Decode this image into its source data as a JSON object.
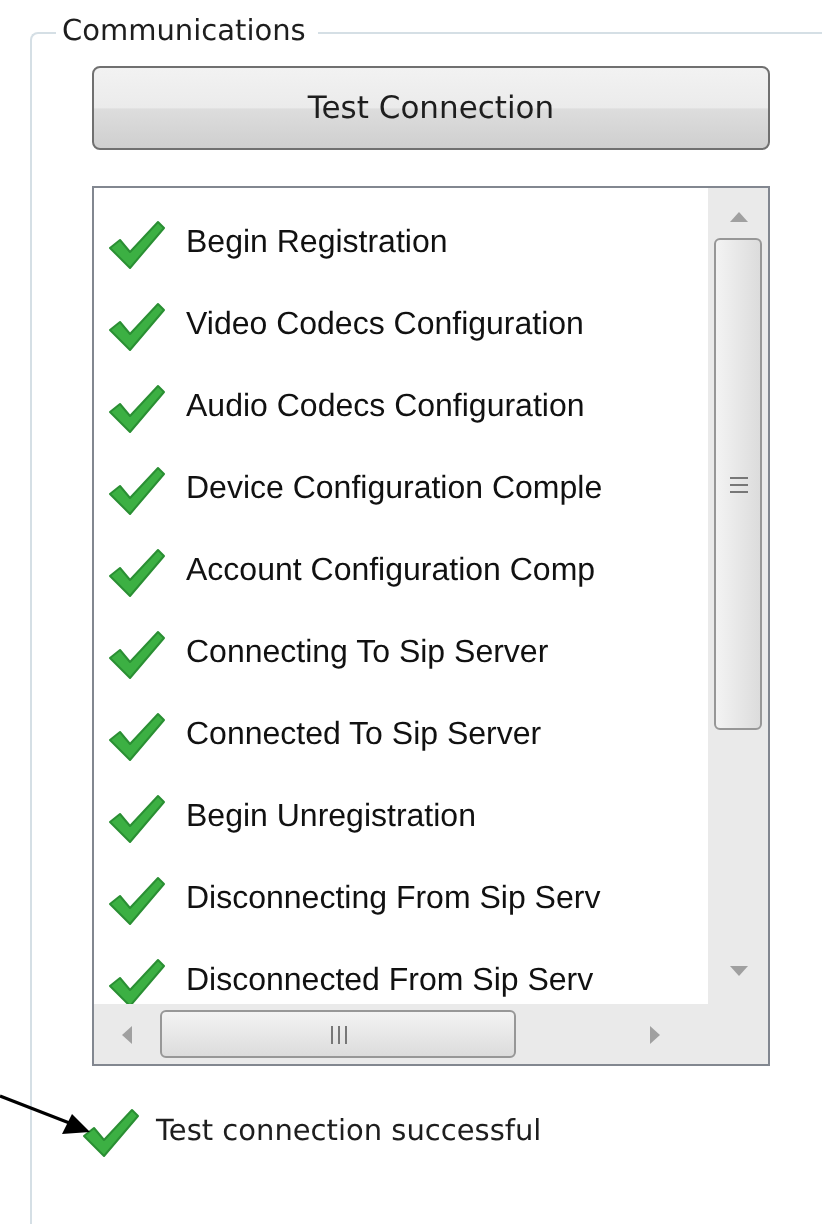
{
  "group": {
    "title": "Communications"
  },
  "test_button": {
    "label": "Test Connection"
  },
  "log": [
    {
      "text": "Begin Registration",
      "done": true
    },
    {
      "text": "Video Codecs Configuration",
      "done": true
    },
    {
      "text": "Audio Codecs Configuration",
      "done": true
    },
    {
      "text": "Device Configuration Comple",
      "done": true
    },
    {
      "text": "Account Configuration Comp",
      "done": true
    },
    {
      "text": "Connecting To Sip Server",
      "done": true
    },
    {
      "text": "Connected To Sip Server",
      "done": true
    },
    {
      "text": "Begin Unregistration",
      "done": true
    },
    {
      "text": "Disconnecting From Sip Serv",
      "done": true
    },
    {
      "text": "Disconnected From Sip Serv",
      "done": true
    }
  ],
  "status": {
    "text": "Test connection successful",
    "done": true
  }
}
